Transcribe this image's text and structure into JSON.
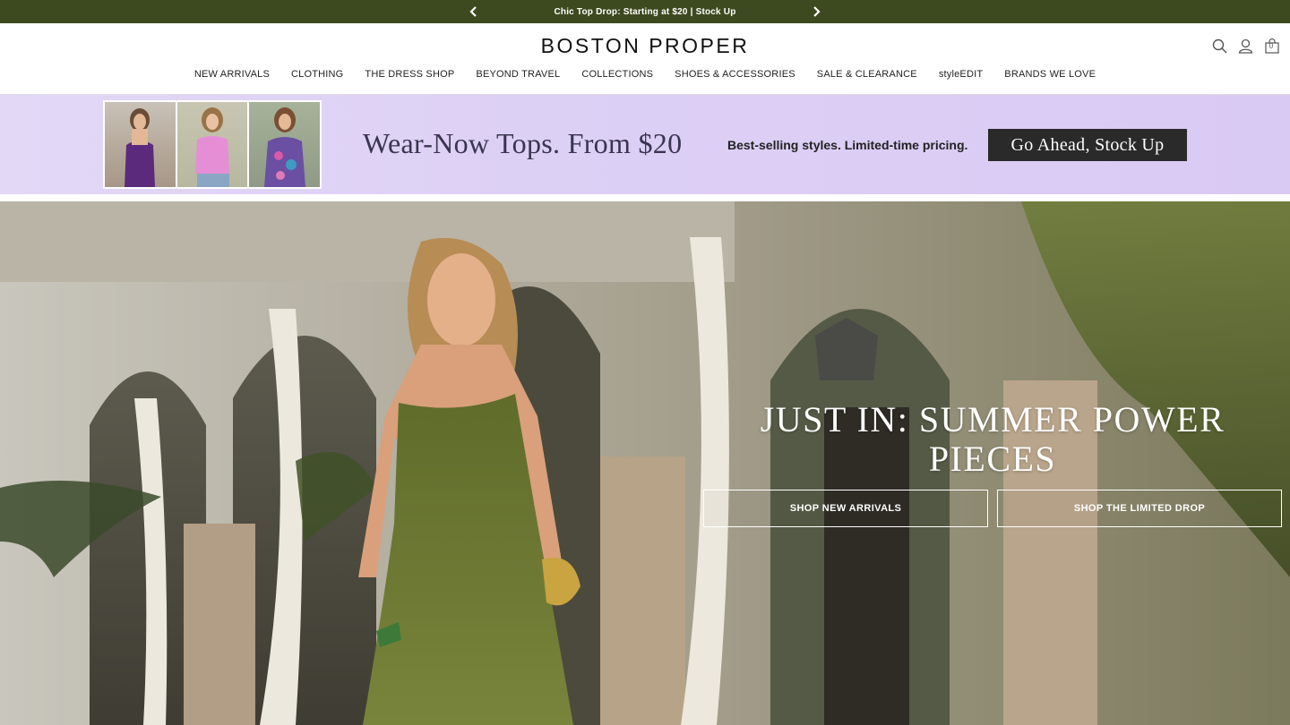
{
  "announcement": {
    "text": "Chic Top Drop: Starting at $20 | Stock Up",
    "prev_icon": "chevron-left-icon",
    "next_icon": "chevron-right-icon"
  },
  "header": {
    "logo": "BOSTON PROPER",
    "icons": [
      "search-icon",
      "account-icon",
      "bag-icon"
    ],
    "bag_count": "0"
  },
  "nav": {
    "items": [
      "NEW ARRIVALS",
      "CLOTHING",
      "THE DRESS SHOP",
      "BEYOND TRAVEL",
      "COLLECTIONS",
      "SHOES & ACCESSORIES",
      "SALE & CLEARANCE",
      "styleEDIT",
      "BRANDS WE LOVE"
    ]
  },
  "promo": {
    "headline": "Wear-Now Tops. From $20",
    "subtext": "Best-selling styles. Limited-time pricing.",
    "cta": "Go Ahead, Stock Up",
    "top_colors": [
      "#5b2a7d",
      "#e58ed6",
      "#6a4fa3"
    ]
  },
  "hero": {
    "title": "JUST IN: SUMMER POWER PIECES",
    "buttons": [
      "SHOP NEW ARRIVALS",
      "SHOP THE LIMITED DROP"
    ],
    "dress_color": "#5c6a28"
  }
}
